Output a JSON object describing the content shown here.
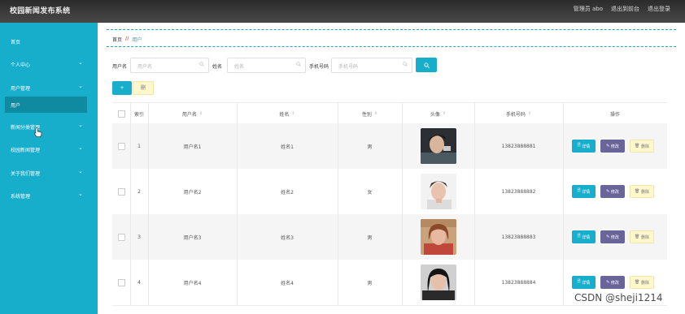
{
  "app": {
    "title": "校园新闻发布系统"
  },
  "topbar": {
    "user": "管理员 abo",
    "home_link": "退出到前台",
    "logout": "退出登录"
  },
  "sidebar": {
    "items": [
      {
        "label": "首页",
        "chevron": false
      },
      {
        "label": "个人中心",
        "chevron": true
      },
      {
        "label": "用户管理",
        "chevron": true
      },
      {
        "label": "用户",
        "chevron": false,
        "active": true
      },
      {
        "label": "新闻分类管理",
        "chevron": true
      },
      {
        "label": "校园新闻管理",
        "chevron": true
      },
      {
        "label": "关于我们管理",
        "chevron": true
      },
      {
        "label": "系统管理",
        "chevron": true
      }
    ]
  },
  "breadcrumb": {
    "home": "首页",
    "separator": "//",
    "current": "用户"
  },
  "filters": {
    "username_label": "用户名",
    "username_placeholder": "用户名",
    "name_label": "姓名",
    "name_placeholder": "姓名",
    "phone_label": "手机号码",
    "phone_placeholder": "手机号码"
  },
  "actions": {
    "add_label": "+",
    "delete_label": "删"
  },
  "table": {
    "headers": {
      "index": "索引",
      "username": "用户名",
      "name": "姓名",
      "gender": "性别",
      "avatar": "头像",
      "phone": "手机号码",
      "ops": "操作"
    },
    "sort_icon": "⇕",
    "rows": [
      {
        "index": "1",
        "username": "用户名1",
        "name": "姓名1",
        "gender": "男",
        "phone": "13823888881",
        "avatar_colors": [
          "#2b2f33",
          "#d9b59c",
          "#4a5a60"
        ]
      },
      {
        "index": "2",
        "username": "用户名2",
        "name": "姓名2",
        "gender": "女",
        "phone": "13823888882",
        "avatar_colors": [
          "#f2f2f2",
          "#e8c3ae",
          "#3a2f2a"
        ]
      },
      {
        "index": "3",
        "username": "用户名3",
        "name": "姓名3",
        "gender": "男",
        "phone": "13823888883",
        "avatar_colors": [
          "#caa27c",
          "#e8b8a0",
          "#8a4a2a"
        ]
      },
      {
        "index": "4",
        "username": "用户名4",
        "name": "姓名4",
        "gender": "男",
        "phone": "13823888884",
        "avatar_colors": [
          "#d0d0d0",
          "#e6c0a8",
          "#151515"
        ]
      }
    ],
    "row_actions": {
      "detail": "详情",
      "edit": "修改",
      "remove": "删除"
    }
  },
  "watermark": "CSDN @sheji1214",
  "colors": {
    "accent": "#17aecc",
    "sidebar_active": "#0f8aa1",
    "edit_button": "#6a6599",
    "delete_button": "#fff8cc",
    "topbar": "#333333"
  }
}
